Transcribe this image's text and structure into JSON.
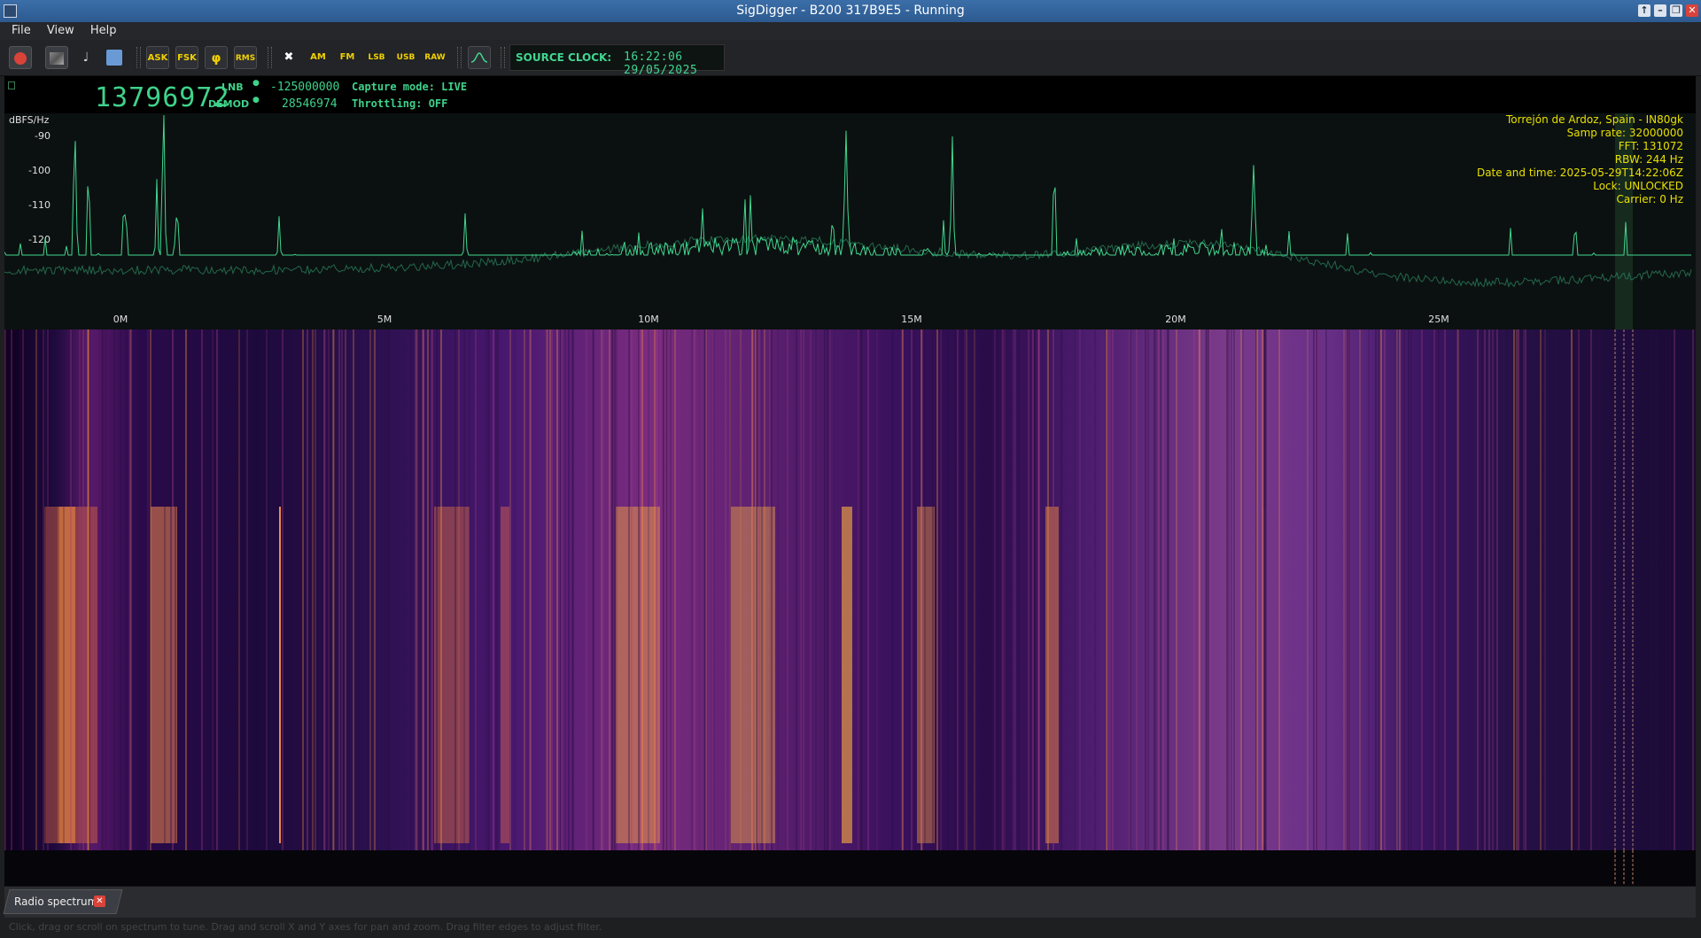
{
  "window": {
    "title": "SigDigger - B200 317B9E5 - Running"
  },
  "menu": [
    "File",
    "View",
    "Help"
  ],
  "toolbar": {
    "buttons": [
      "ASK",
      "FSK",
      "φ",
      "RMS",
      "✖",
      "AM",
      "FM",
      "LSB",
      "USB",
      "RAW"
    ],
    "clock_label": "SOURCE CLOCK:",
    "clock_value": "16:22:06 29/05/2025"
  },
  "lcd": {
    "frequency": "13796972",
    "lnb_label": "LNB",
    "lnb_value": "-125000000",
    "demod_label": "DEMOD",
    "demod_value": "28546974",
    "capture_mode": "Capture mode: LIVE",
    "throttling": "Throttling: OFF"
  },
  "spectrum": {
    "y_unit": "dBFS/Hz",
    "y_ticks": [
      "-90",
      "-100",
      "-110",
      "-120"
    ],
    "x_ticks": [
      "0M",
      "5M",
      "10M",
      "15M",
      "20M",
      "25M"
    ],
    "trace_color": "#41d690",
    "info": [
      "Torrejón de Ardoz, Spain - IN80gk",
      "Samp rate: 32000000",
      "FFT: 131072",
      "RBW: 244 Hz",
      "Date and time: 2025-05-29T14:22:06Z",
      "Lock: UNLOCKED",
      "Carrier: 0 Hz"
    ]
  },
  "tabs": [
    {
      "label": "Radio spectrum"
    }
  ],
  "status": "Click, drag or scroll on spectrum to tune. Drag and scroll X and Y axes for pan and zoom. Drag filter edges to adjust filter."
}
